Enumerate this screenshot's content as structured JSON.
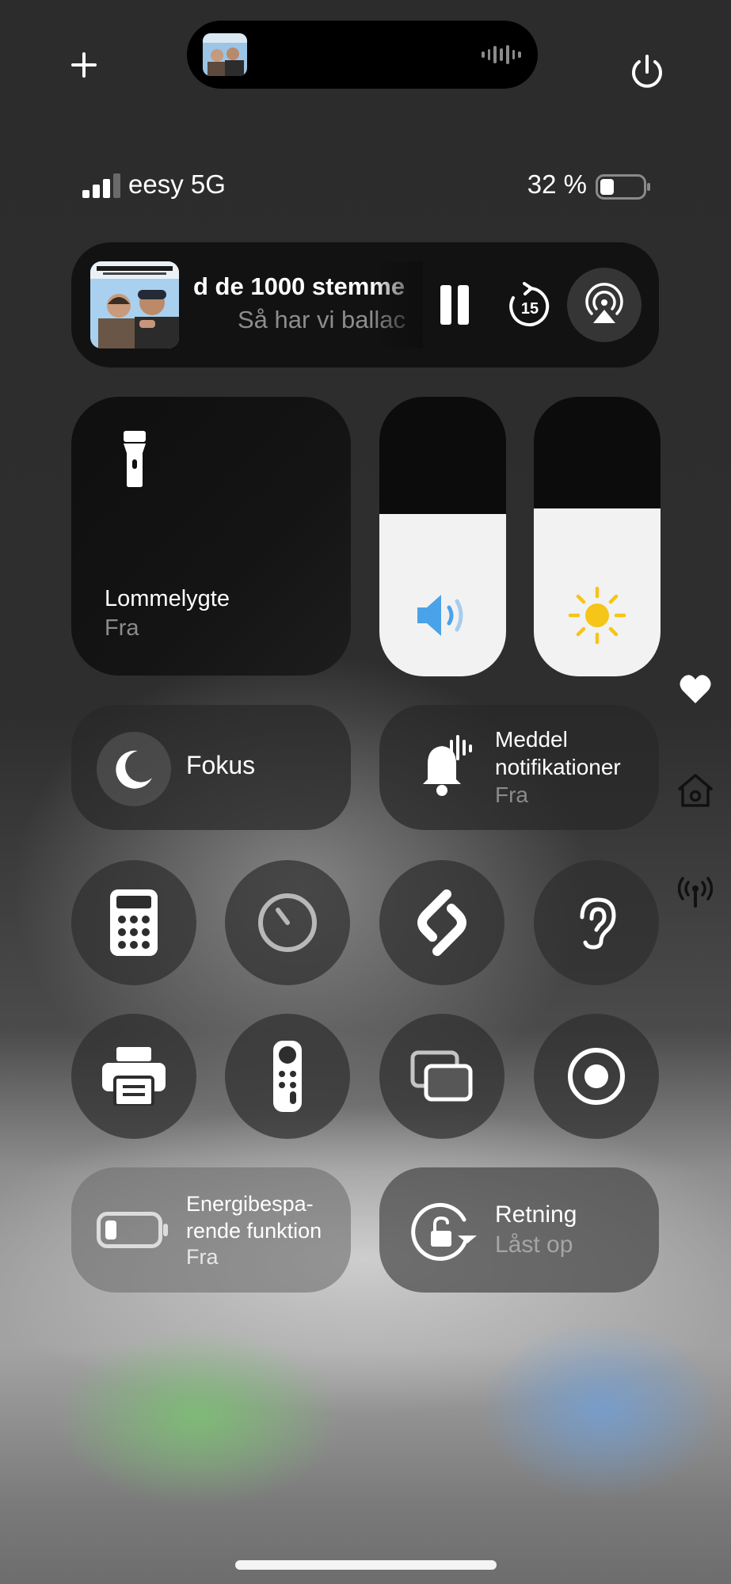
{
  "status_bar": {
    "carrier": "eesy 5G",
    "battery_percent": "32 %",
    "battery_level": 0.32,
    "signal_bars": 3
  },
  "now_playing": {
    "title": "d de 1000 stemme",
    "subtitle": "Så har vi ballac",
    "artwork_text": "SÅ HAR VI BALLADEN",
    "skip_seconds": "15"
  },
  "flashlight": {
    "title": "Lommelygte",
    "status": "Fra"
  },
  "sliders": {
    "volume_level": 0.58,
    "brightness_level": 0.6
  },
  "focus": {
    "label": "Fokus"
  },
  "notifications": {
    "line1": "Meddel",
    "line2": "notifikationer",
    "status": "Fra"
  },
  "low_power": {
    "line1": "Energibespa-",
    "line2": "rende funktion",
    "status": "Fra"
  },
  "orientation": {
    "title": "Retning",
    "status": "Låst op"
  },
  "colors": {
    "volume_accent": "#4aa3e8",
    "brightness_accent": "#f5c518"
  }
}
